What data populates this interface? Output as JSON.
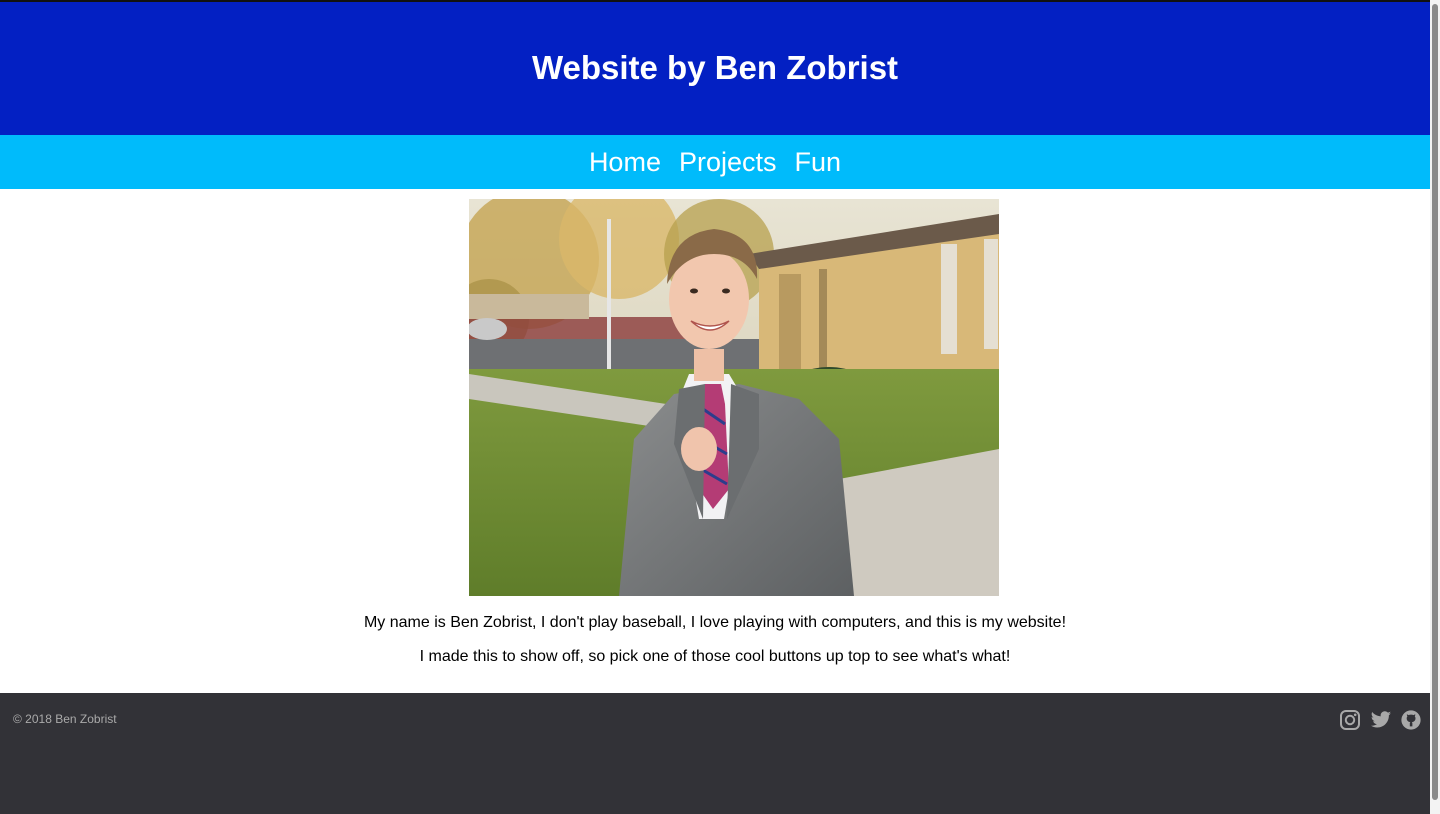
{
  "header": {
    "title": "Website by Ben Zobrist"
  },
  "nav": {
    "home": "Home",
    "projects": "Projects",
    "fun": "Fun"
  },
  "main": {
    "intro_line1": "My name is Ben Zobrist, I don't play baseball, I love playing with computers, and this is my website!",
    "intro_line2": "I made this to show off, so pick one of those cool buttons up top to see what's what!"
  },
  "footer": {
    "copyright": "© 2018 Ben Zobrist",
    "social_icons": [
      "instagram-icon",
      "twitter-icon",
      "github-icon"
    ]
  },
  "colors": {
    "header_bg": "#0320c3",
    "nav_bg": "#00bbfb",
    "footer_bg": "#323237",
    "footer_text": "#aaaaaa"
  }
}
